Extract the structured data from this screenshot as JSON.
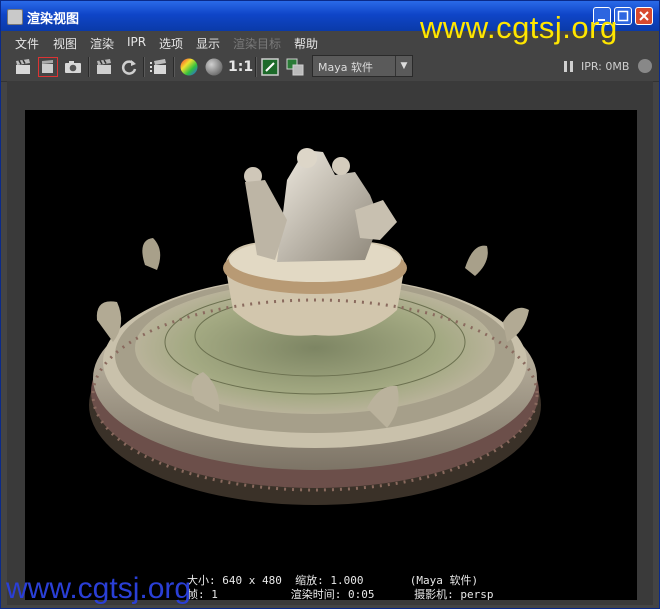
{
  "window": {
    "title": "渲染视图",
    "watermark": "www.cgtsj.org"
  },
  "menus": [
    {
      "label": "文件",
      "enabled": true
    },
    {
      "label": "视图",
      "enabled": true
    },
    {
      "label": "渲染",
      "enabled": true
    },
    {
      "label": "IPR",
      "enabled": true
    },
    {
      "label": "选项",
      "enabled": true
    },
    {
      "label": "显示",
      "enabled": true
    },
    {
      "label": "渲染目标",
      "enabled": false
    },
    {
      "label": "帮助",
      "enabled": true
    }
  ],
  "toolbar": {
    "ratio_label": "1:1",
    "renderer_selected": "Maya 软件",
    "ipr_status": "IPR: 0MB"
  },
  "render_info": {
    "line1": "大小: 640 x 480  缩放: 1.000       (Maya 软件)",
    "line2": "帧: 1           渲染时间: 0:05      摄影机: persp"
  },
  "colors": {
    "title_bar": "#0f45c8",
    "watermark_top": "#ffe600",
    "watermark_bottom": "#2a3fd6",
    "panel": "#444444"
  }
}
